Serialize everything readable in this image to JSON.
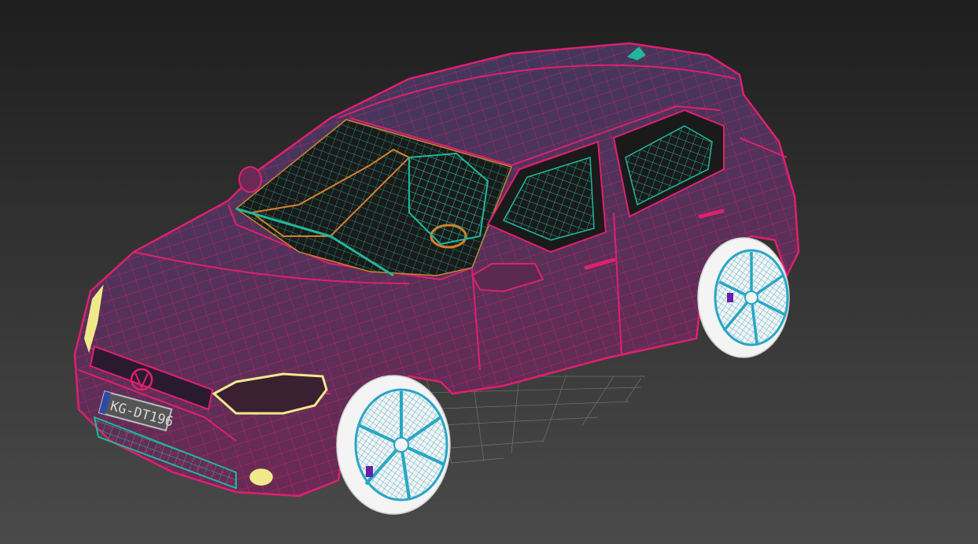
{
  "viewport": {
    "background_top": "#1e1e1e",
    "background_bottom": "#4a4a4a",
    "grid_color": "#9a9a9a"
  },
  "model": {
    "body_wire_color": "#e0206e",
    "body_fill_top": "#3a3a5e",
    "body_fill_bottom": "#6a2a55",
    "interior_wire_color": "#1fb89a",
    "interior_accent_color": "#d6802a",
    "headlight_color": "#f0e98a",
    "wheel_color": "#2aa6c4",
    "tire_color": "#f4f4f4",
    "grille_color": "#1fb89a",
    "license_plate_text": "KG-DT196",
    "icons": [
      "vw-badge-icon",
      "antenna-icon"
    ]
  }
}
